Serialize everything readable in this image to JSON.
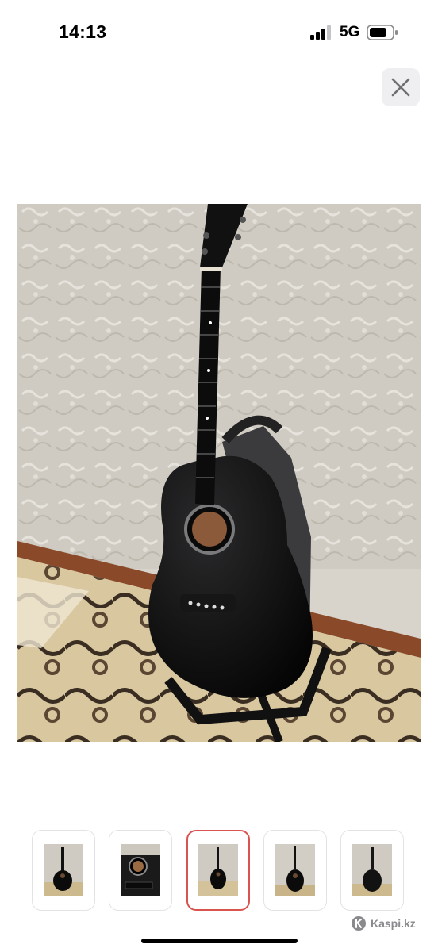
{
  "status_bar": {
    "time": "14:13",
    "network": "5G",
    "icons": [
      "signal-bars-icon",
      "battery-icon"
    ]
  },
  "viewer": {
    "close_icon": "close-icon",
    "selected_index": 2,
    "thumbnails": [
      {
        "icon": "guitar-full-thumb"
      },
      {
        "icon": "guitar-soundhole-closeup-thumb"
      },
      {
        "icon": "guitar-on-stand-thumb"
      },
      {
        "icon": "guitar-front-thumb"
      },
      {
        "icon": "guitar-back-thumb"
      }
    ]
  },
  "branding": {
    "text": "Kaspi.kz",
    "icon": "kaspi-logo-icon"
  },
  "colors": {
    "background": "#ffffff",
    "close_button_bg": "#efeff1",
    "selected_border": "#d9534f"
  }
}
